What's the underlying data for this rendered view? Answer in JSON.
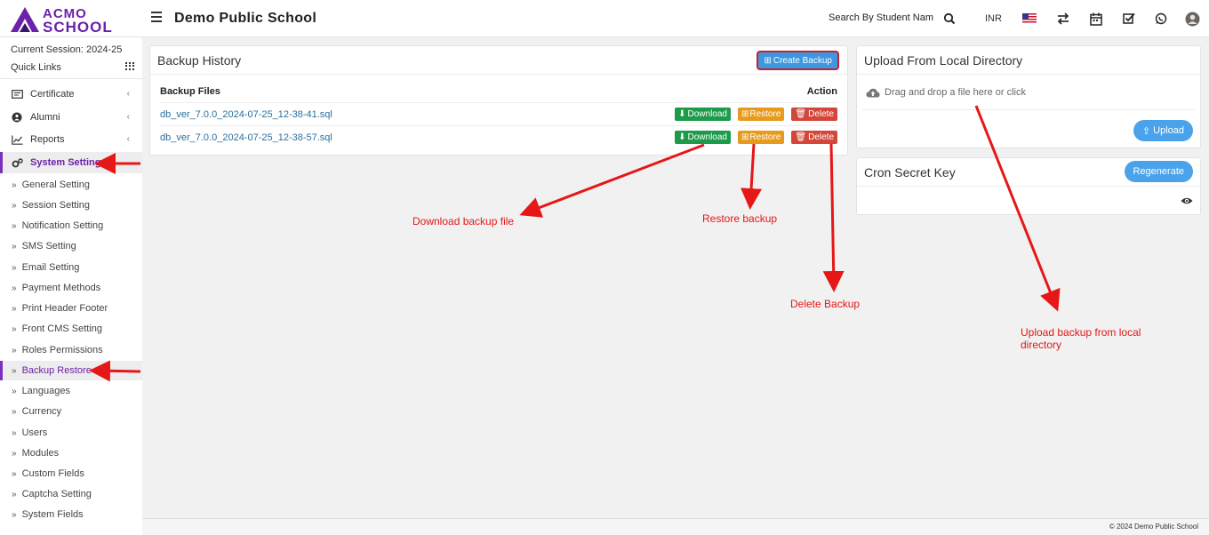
{
  "header": {
    "logo_top": "ACMO",
    "logo_bottom": "SCHOOL",
    "school_name": "Demo Public School",
    "search_placeholder": "Search By Student Nam",
    "currency": "INR"
  },
  "sidebar": {
    "session": "Current Session: 2024-25",
    "quick_links": "Quick Links",
    "menu": [
      {
        "label": "Certificate",
        "icon": "certificate-icon"
      },
      {
        "label": "Alumni",
        "icon": "alumni-icon"
      },
      {
        "label": "Reports",
        "icon": "reports-icon"
      },
      {
        "label": "System Setting",
        "icon": "gears-icon"
      }
    ],
    "submenu": [
      "General Setting",
      "Session Setting",
      "Notification Setting",
      "SMS Setting",
      "Email Setting",
      "Payment Methods",
      "Print Header Footer",
      "Front CMS Setting",
      "Roles Permissions",
      "Backup Restore",
      "Languages",
      "Currency",
      "Users",
      "Modules",
      "Custom Fields",
      "Captcha Setting",
      "System Fields"
    ]
  },
  "backup": {
    "title": "Backup History",
    "create_label": "Create Backup",
    "col_files": "Backup Files",
    "col_action": "Action",
    "files": [
      "db_ver_7.0.0_2024-07-25_12-38-41.sql",
      "db_ver_7.0.0_2024-07-25_12-38-57.sql"
    ],
    "download_label": "Download",
    "restore_label": "Restore",
    "delete_label": "Delete"
  },
  "upload": {
    "title": "Upload From Local Directory",
    "dropzone_text": "Drag and drop a file here or click",
    "upload_label": "Upload"
  },
  "cron": {
    "title": "Cron Secret Key",
    "regenerate_label": "Regenerate"
  },
  "annotations": {
    "download": "Download backup file",
    "restore": "Restore backup",
    "delete": "Delete Backup",
    "upload_line1": "Upload backup from local",
    "upload_line2": "directory"
  },
  "footer": {
    "copyright": "© 2024 Demo Public School"
  },
  "colors": {
    "brand_purple": "#6b21a8",
    "download_green": "#1d9a4a",
    "restore_orange": "#e79b1e",
    "delete_red": "#d2473a",
    "primary_blue": "#3d98e0",
    "annotation_red": "#e51717"
  }
}
